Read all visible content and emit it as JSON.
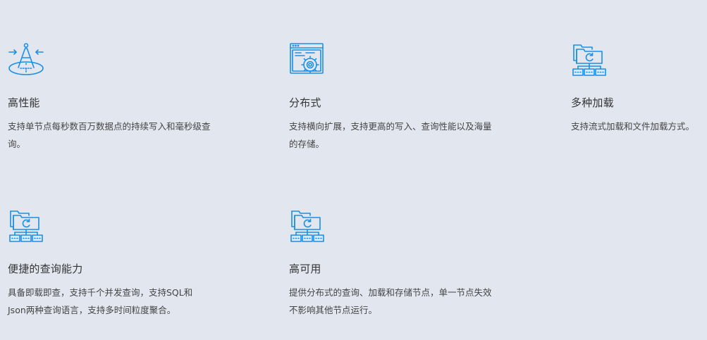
{
  "features": [
    {
      "icon": "compass-icon",
      "title": "高性能",
      "desc": "支持单节点每秒数百万数据点的持续写入和毫秒级查询。"
    },
    {
      "icon": "browser-gear-icon",
      "title": "分布式",
      "desc": "支持横向扩展，支持更高的写入、查询性能以及海量的存储。"
    },
    {
      "icon": "folder-sync-network-icon",
      "title": "多种加载",
      "desc": "支持流式加载和文件加载方式。"
    },
    {
      "icon": "folder-sync-network-icon",
      "title": "便捷的查询能力",
      "desc": "具备即载即查，支持千个并发查询，支持SQL和Json两种查询语言，支持多时间粒度聚合。"
    },
    {
      "icon": "folder-sync-network-icon",
      "title": "高可用",
      "desc": "提供分布式的查询、加载和存储节点，单一节点失效不影响其他节点运行。"
    }
  ],
  "colors": {
    "background": "#e2e7ef",
    "icon": "#1a8fe3",
    "title": "#333333",
    "text": "#444444"
  }
}
